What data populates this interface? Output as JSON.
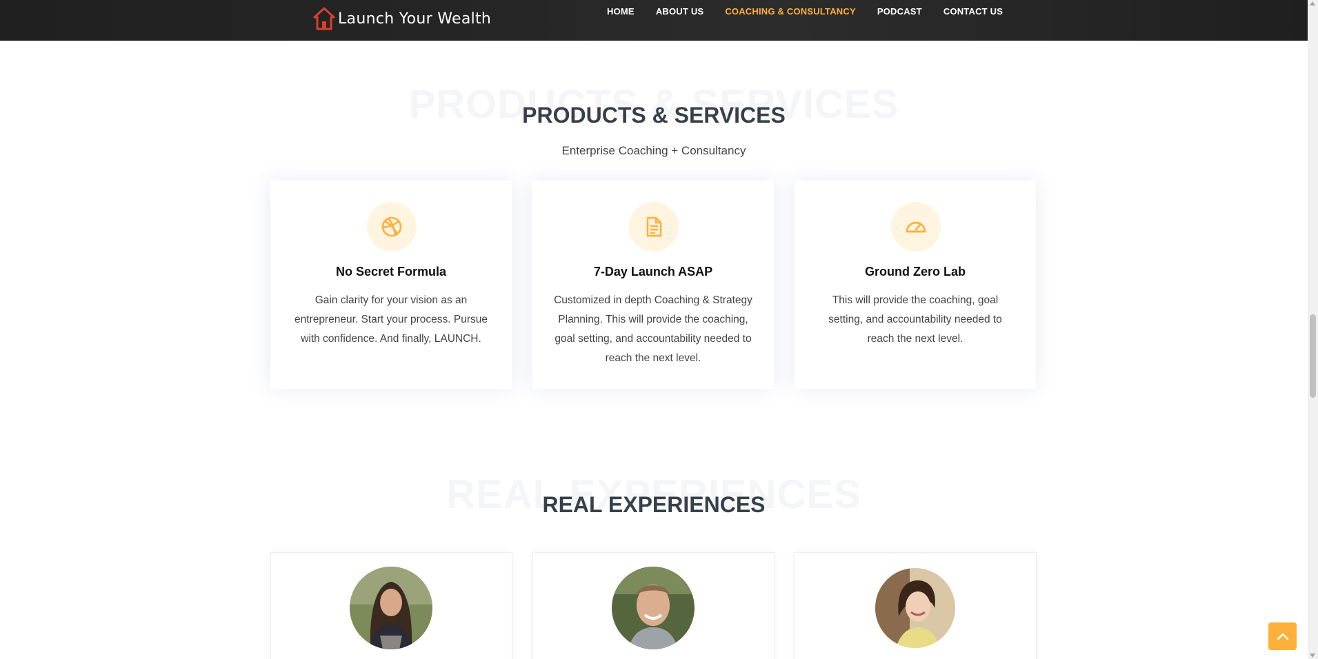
{
  "header": {
    "logo_text": "Launch Your Wealth",
    "nav": [
      {
        "label": "HOME",
        "active": false
      },
      {
        "label": "ABOUT US",
        "active": false
      },
      {
        "label": "COACHING & CONSULTANCY",
        "active": true
      },
      {
        "label": "PODCAST",
        "active": false
      },
      {
        "label": "CONTACT US",
        "active": false
      }
    ]
  },
  "services": {
    "title_bg": "PRODUCTS & SERVICES",
    "title": "PRODUCTS & SERVICES",
    "subtitle": "Enterprise Coaching + Consultancy",
    "cards": [
      {
        "icon": "dribbble-icon",
        "title": "No Secret Formula",
        "text": "Gain clarity for your vision as an entrepreneur. Start your process. Pursue with confidence. And finally, LAUNCH."
      },
      {
        "icon": "file-text-icon",
        "title": "7-Day Launch ASAP",
        "text": "Customized in depth Coaching & Strategy Planning. This will provide the coaching, goal setting, and accountability needed to reach the next level."
      },
      {
        "icon": "speedometer-icon",
        "title": "Ground Zero Lab",
        "text": "This will provide the coaching, goal setting, and accountability needed to reach the next level."
      }
    ]
  },
  "testimonials": {
    "title_bg": "REAL EXPERIENCES",
    "title": "REAL EXPERIENCES",
    "avatars": [
      "avatar-woman-dark-hair",
      "avatar-man-smiling",
      "avatar-woman-updo"
    ]
  },
  "colors": {
    "accent": "#ffb03b",
    "heading": "#37404a",
    "header_bg": "#262626",
    "icon_bg": "#fff4e0"
  }
}
